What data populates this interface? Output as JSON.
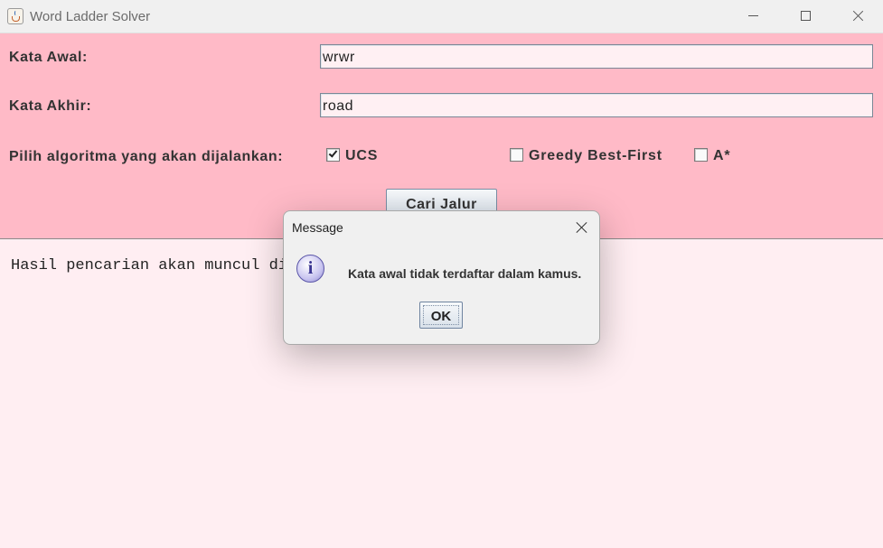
{
  "window": {
    "title": "Word Ladder Solver"
  },
  "form": {
    "start_label": "Kata Awal:",
    "start_value": "wrwr",
    "end_label": "Kata Akhir:",
    "end_value": "road",
    "algo_label": "Pilih algoritma yang akan dijalankan:",
    "algorithms": [
      {
        "label": "UCS",
        "checked": true
      },
      {
        "label": "Greedy Best-First",
        "checked": false
      },
      {
        "label": "A*",
        "checked": false
      }
    ],
    "search_button": "Cari Jalur"
  },
  "result": {
    "text": "Hasil pencarian akan muncul di sini"
  },
  "dialog": {
    "title": "Message",
    "icon": "info-icon",
    "message": "Kata awal tidak terdaftar dalam kamus.",
    "ok_label": "OK"
  },
  "colors": {
    "panel_bg": "#ffbac7",
    "result_bg": "#ffeef2"
  }
}
